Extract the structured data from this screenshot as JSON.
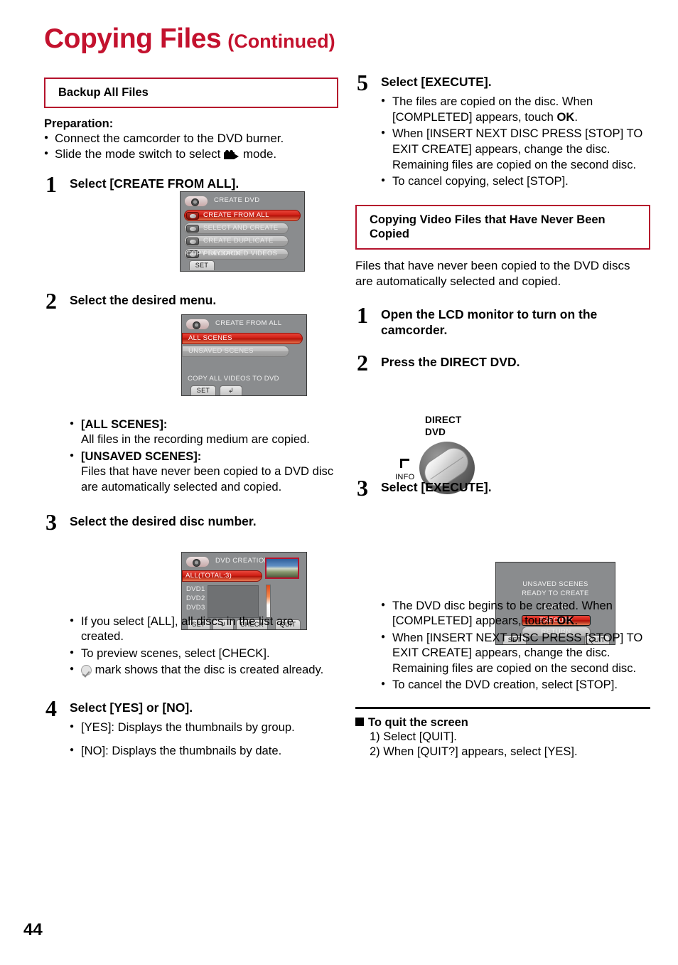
{
  "title": {
    "main": "Copying Files",
    "continued": "(Continued)",
    "color": "#c3122e"
  },
  "page_number": "44",
  "left_column": {
    "section_heading": "Backup All Files",
    "preparation_label": "Preparation:",
    "preparation_items": [
      "Connect the camcorder to the DVD burner.",
      "Slide the mode switch to select"
    ],
    "preparation_item2_suffix": "mode.",
    "steps": [
      {
        "number": "1",
        "title": "Select [CREATE FROM ALL].",
        "screen": {
          "header": "CREATE DVD",
          "items": [
            {
              "label": "CREATE FROM ALL",
              "selected": true
            },
            {
              "label": "SELECT AND CREATE",
              "selected": false
            },
            {
              "label": "CREATE DUPLICATE",
              "selected": false
            },
            {
              "label": "PLAYBACK",
              "selected": false
            }
          ],
          "footer": "COPY RECORDED VIDEOS",
          "buttons": [
            "SET"
          ]
        }
      },
      {
        "number": "2",
        "title": "Select the desired menu.",
        "screen": {
          "header": "CREATE FROM ALL",
          "items": [
            {
              "label": "ALL SCENES",
              "selected": true
            },
            {
              "label": "UNSAVED SCENES",
              "selected": false
            }
          ],
          "footer": "COPY ALL VIDEOS TO DVD",
          "buttons": [
            "SET",
            "back-arrow"
          ]
        },
        "notes": [
          {
            "label": "[ALL SCENES]:",
            "text": "All files in the recording medium are copied."
          },
          {
            "label": "[UNSAVED SCENES]:",
            "text": "Files that have never been copied to a DVD disc are automatically selected and copied."
          }
        ]
      },
      {
        "number": "3",
        "title": "Select the desired disc number.",
        "screen": {
          "header": "DVD CREATION LIST",
          "selected_row": "ALL(TOTAL:3)",
          "disc_list": [
            "DVD1",
            "DVD2",
            "DVD3"
          ],
          "buttons": [
            "SET",
            "back-arrow",
            "CHECK",
            "QUIT"
          ]
        },
        "bullets": [
          "If you select [ALL], all discs in the list are created.",
          "To preview scenes, select [CHECK].",
          "mark shows that the disc is created already."
        ]
      },
      {
        "number": "4",
        "title": "Select [YES] or [NO].",
        "bullets": [
          "[YES]: Displays the thumbnails by group.",
          "[NO]: Displays the thumbnails by date."
        ]
      }
    ]
  },
  "right_column": {
    "step5": {
      "number": "5",
      "title": "Select [EXECUTE].",
      "bullets": [
        "The files are copied on the disc. When [COMPLETED] appears, touch OK.",
        "When [INSERT NEXT DISC PRESS [STOP] TO EXIT CREATE] appears, change the disc. Remaining files are copied on the second disc.",
        "To cancel copying, select [STOP]."
      ]
    },
    "section_heading": "Copying Video Files that Have Never Been Copied",
    "intro": "Files that have never been copied to the DVD discs are automatically selected and copied.",
    "steps": [
      {
        "number": "1",
        "title": "Open the LCD monitor to turn on the camcorder."
      },
      {
        "number": "2",
        "title": "Press the DIRECT DVD."
      },
      {
        "number": "3",
        "title": "Select [EXECUTE]."
      }
    ],
    "direct_dvd_art": {
      "label_line1": "DIRECT",
      "label_line2": "DVD",
      "info_label": "INFO"
    },
    "step3_screen": {
      "line1": "UNSAVED SCENES",
      "line2": "READY TO CREATE",
      "disc_type": "DVD-R",
      "execute": "EXECUTE",
      "return": "RETURN",
      "buttons": [
        "SET",
        "QUIT"
      ]
    },
    "step3_bullets": [
      "The DVD disc begins to be created. When [COMPLETED] appears, touch OK.",
      "When [INSERT NEXT DISC PRESS [STOP] TO EXIT CREATE] appears, change the disc. Remaining files are copied on the second disc.",
      "To cancel the DVD creation, select [STOP]."
    ],
    "quit_section": {
      "heading": "To quit the screen",
      "items": [
        "1) Select [QUIT].",
        "2) When [QUIT?] appears, select [YES]."
      ]
    }
  }
}
